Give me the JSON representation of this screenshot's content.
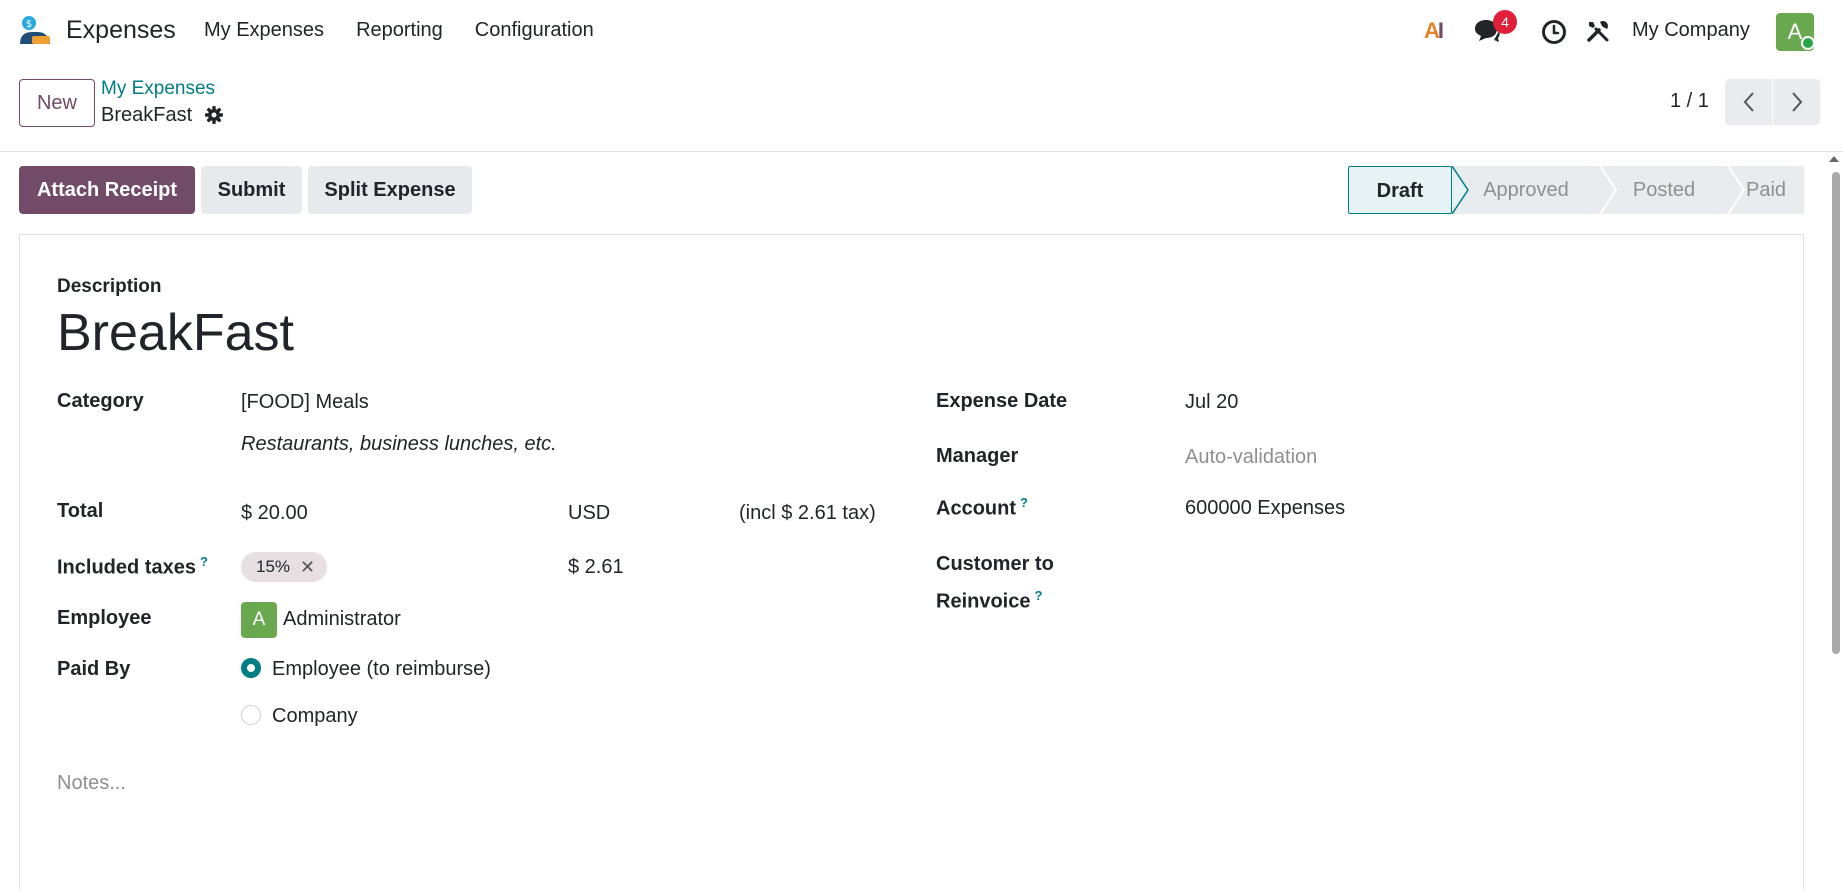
{
  "navbar": {
    "app_name": "Expenses",
    "menu": [
      "My Expenses",
      "Reporting",
      "Configuration"
    ],
    "ai_label_1": "A",
    "ai_label_2": "I",
    "chat_badge": "4",
    "company": "My Company",
    "avatar_initial": "A",
    "icons": [
      "expenses-logo-icon",
      "ai-icon",
      "chat-icon",
      "clock-icon",
      "tools-icon"
    ]
  },
  "control": {
    "new_label": "New",
    "breadcrumb_parent": "My Expenses",
    "breadcrumb_current": "BreakFast",
    "pager": "1 / 1"
  },
  "actions": {
    "attach": "Attach Receipt",
    "submit": "Submit",
    "split": "Split Expense"
  },
  "stages": {
    "items": [
      "Draft",
      "Approved",
      "Posted",
      "Paid"
    ],
    "current": "Draft"
  },
  "form": {
    "description_label": "Description",
    "title": "BreakFast",
    "category_label": "Category",
    "category_value": "[FOOD] Meals",
    "category_note": "Restaurants, business lunches, etc.",
    "total_label": "Total",
    "total_value": "$ 20.00",
    "currency": "USD",
    "tax_note": "(incl $ 2.61 tax)",
    "taxes_label": "Included taxes",
    "help_mark": "?",
    "tax_tag": "15%",
    "tax_remove": "✕",
    "tax_amount": "$ 2.61",
    "employee_label": "Employee",
    "employee_initial": "A",
    "employee_value": "Administrator",
    "paid_by_label": "Paid By",
    "paid_by_options": [
      "Employee (to reimburse)",
      "Company"
    ],
    "paid_by_selected": "Employee (to reimburse)",
    "notes_placeholder": "Notes...",
    "expense_date_label": "Expense Date",
    "expense_date_value": "Jul 20",
    "manager_label": "Manager",
    "manager_placeholder": "Auto-validation",
    "account_label": "Account",
    "account_value": "600000 Expenses",
    "customer_label_1": "Customer to",
    "customer_label_2": "Reinvoice"
  },
  "colors": {
    "brand": "#714b67",
    "accent": "#017e84",
    "badge": "#e0203b",
    "avatar": "#6aa84f"
  }
}
